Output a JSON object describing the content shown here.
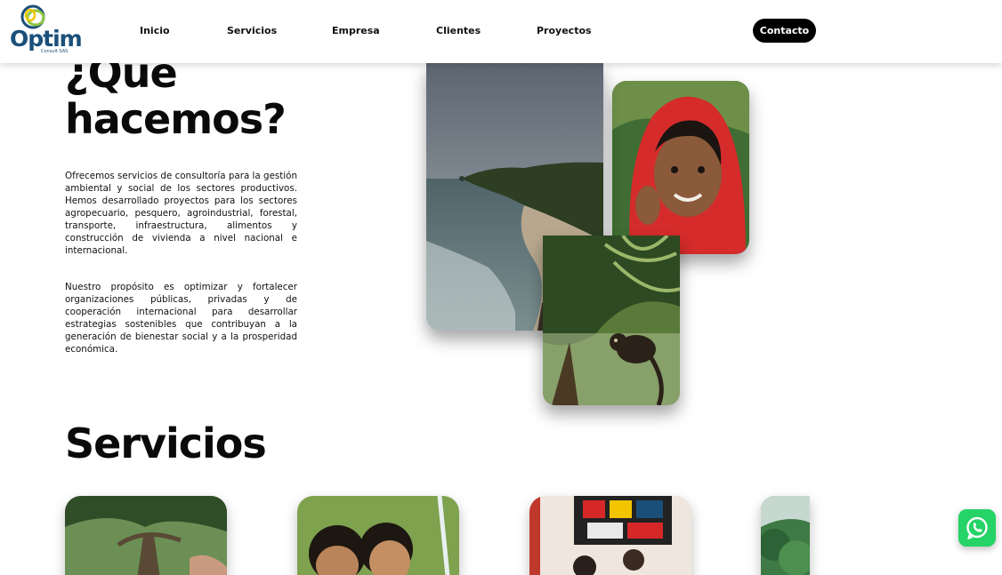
{
  "brand": {
    "name": "Optim",
    "subtitle": "Consult SAS",
    "colors": {
      "primary": "#1a4f7a",
      "accent_green": "#8cc63f",
      "accent_yellow": "#f2c500"
    }
  },
  "nav": {
    "items": [
      {
        "label": "Inicio"
      },
      {
        "label": "Servicios"
      },
      {
        "label": "Empresa"
      },
      {
        "label": "Clientes"
      },
      {
        "label": "Proyectos"
      }
    ],
    "contact_label": "Contacto"
  },
  "about": {
    "title": "¿Que hacemos?",
    "paragraph_1": "Ofrecemos servicios de consultoría para la gestión ambiental y social de los sectores productivos. Hemos desarrollado proyectos para los sectores agropecuario, pesquero, agroindustrial, forestal, transporte, infraestructura, alimentos y construcción de vivienda a nivel nacional e internacional.",
    "paragraph_2": "Nuestro propósito es optimizar y fortalecer organizaciones públicas, privadas y de cooperación internacional para desarrollar estrategias sostenibles que contribuyan a la generación de bienestar social y a la prosperidad económica.",
    "images": [
      {
        "icon": "coastline-photo"
      },
      {
        "icon": "child-portrait-photo"
      },
      {
        "icon": "monkey-photo"
      }
    ]
  },
  "services": {
    "title": "Servicios",
    "cards": [
      {
        "icon": "tree-photo"
      },
      {
        "icon": "children-photo"
      },
      {
        "icon": "meeting-photo"
      },
      {
        "icon": "forest-photo"
      }
    ]
  },
  "whatsapp": {
    "icon": "whatsapp-icon",
    "color": "#25d366"
  }
}
